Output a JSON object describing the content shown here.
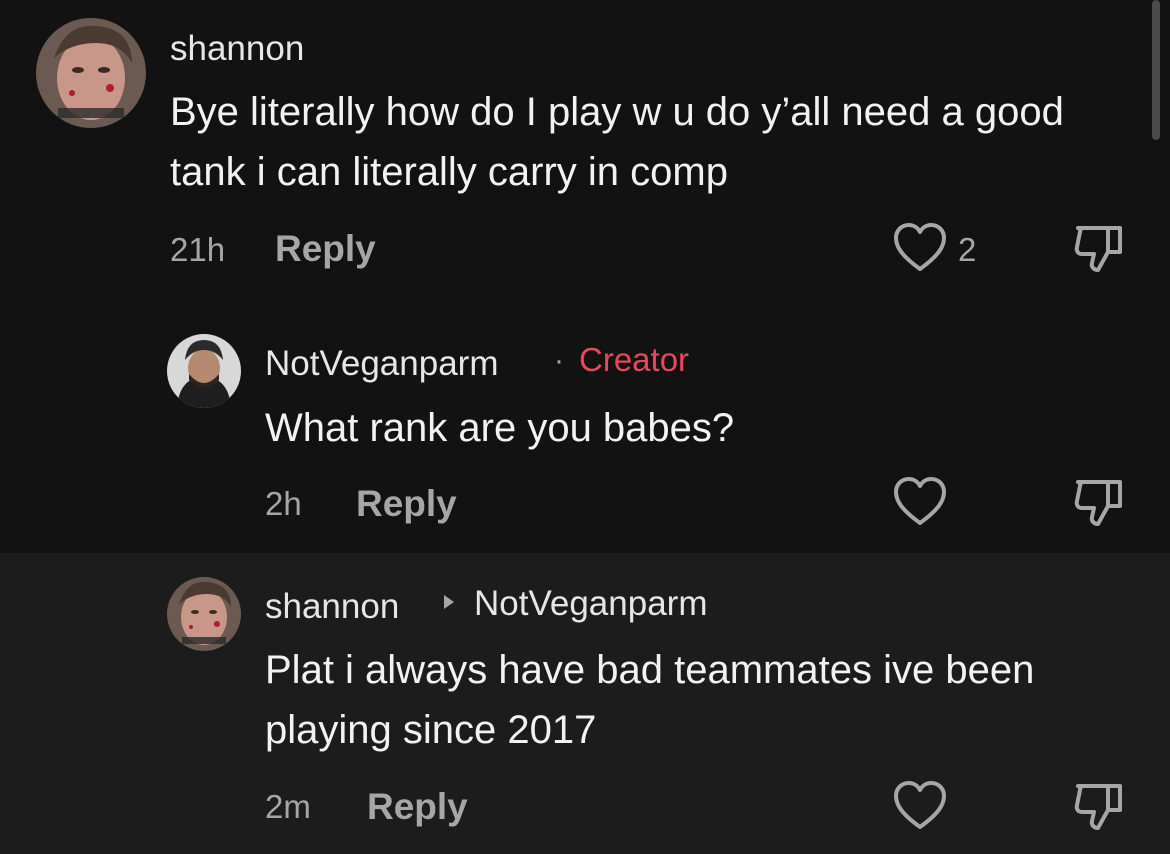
{
  "comments": [
    {
      "username": "shannon",
      "text": "Bye literally how do I play w u do y’all need a good tank i can literally carry in comp",
      "time": "21h",
      "reply_label": "Reply",
      "like_count": "2"
    },
    {
      "username": "NotVeganparm",
      "badge_separator": "·",
      "badge": "Creator",
      "text": "What rank are you babes?",
      "time": "2h",
      "reply_label": "Reply"
    },
    {
      "username": "shannon",
      "reply_to": "NotVeganparm",
      "text": "Plat i always have bad teammates ive been playing since 2017",
      "time": "2m",
      "reply_label": "Reply"
    }
  ],
  "colors": {
    "background": "#121212",
    "highlight_background": "#1c1c1c",
    "creator_badge": "#e8475e",
    "secondary_text": "#a6a6a6"
  },
  "icons": [
    "heart-icon",
    "thumbs-down-icon",
    "reply-arrow-icon"
  ]
}
